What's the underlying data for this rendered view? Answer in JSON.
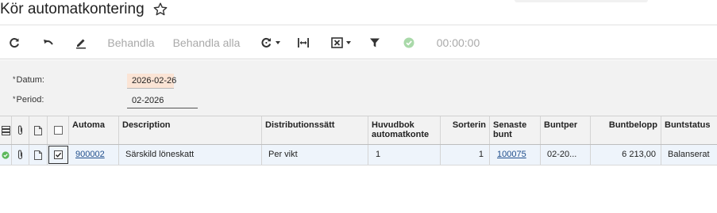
{
  "page": {
    "title": "Kör automatkontering"
  },
  "toolbar": {
    "refresh_icon": "refresh-icon",
    "undo_icon": "undo-icon",
    "edit_icon": "pencil-icon",
    "process_label": "Behandla",
    "process_all_label": "Behandla alla",
    "reload_icon": "reload-dropdown-icon",
    "fit_icon": "fit-columns-icon",
    "excel_icon": "excel-dropdown-icon",
    "filter_icon": "filter-icon",
    "status_icon": "check-circle-icon",
    "timer": "00:00:00"
  },
  "form": {
    "date_label": "Datum:",
    "date_value": "2026-02-26",
    "period_label": "Period:",
    "period_value": "02-2026",
    "required_marker": "*"
  },
  "grid": {
    "columns": [
      "Automa",
      "Description",
      "Distributionssätt",
      "Huvudbok automatkonte",
      "Sorterin",
      "Senaste bunt",
      "Buntper",
      "Buntbelopp",
      "Buntstatus"
    ],
    "rows": [
      {
        "status": "ok",
        "selected": true,
        "automa": "900002",
        "description": "Särskild löneskatt",
        "distribution": "Per vikt",
        "ledger": "1",
        "sort": "1",
        "latest_batch": "100075",
        "batch_period": "02-20...",
        "batch_amount": "6 213,00",
        "batch_status": "Balanserat"
      }
    ]
  },
  "colors": {
    "accent_green": "#5cb85c",
    "link": "#1f4e8c",
    "date_highlight": "#fbe4d5"
  }
}
